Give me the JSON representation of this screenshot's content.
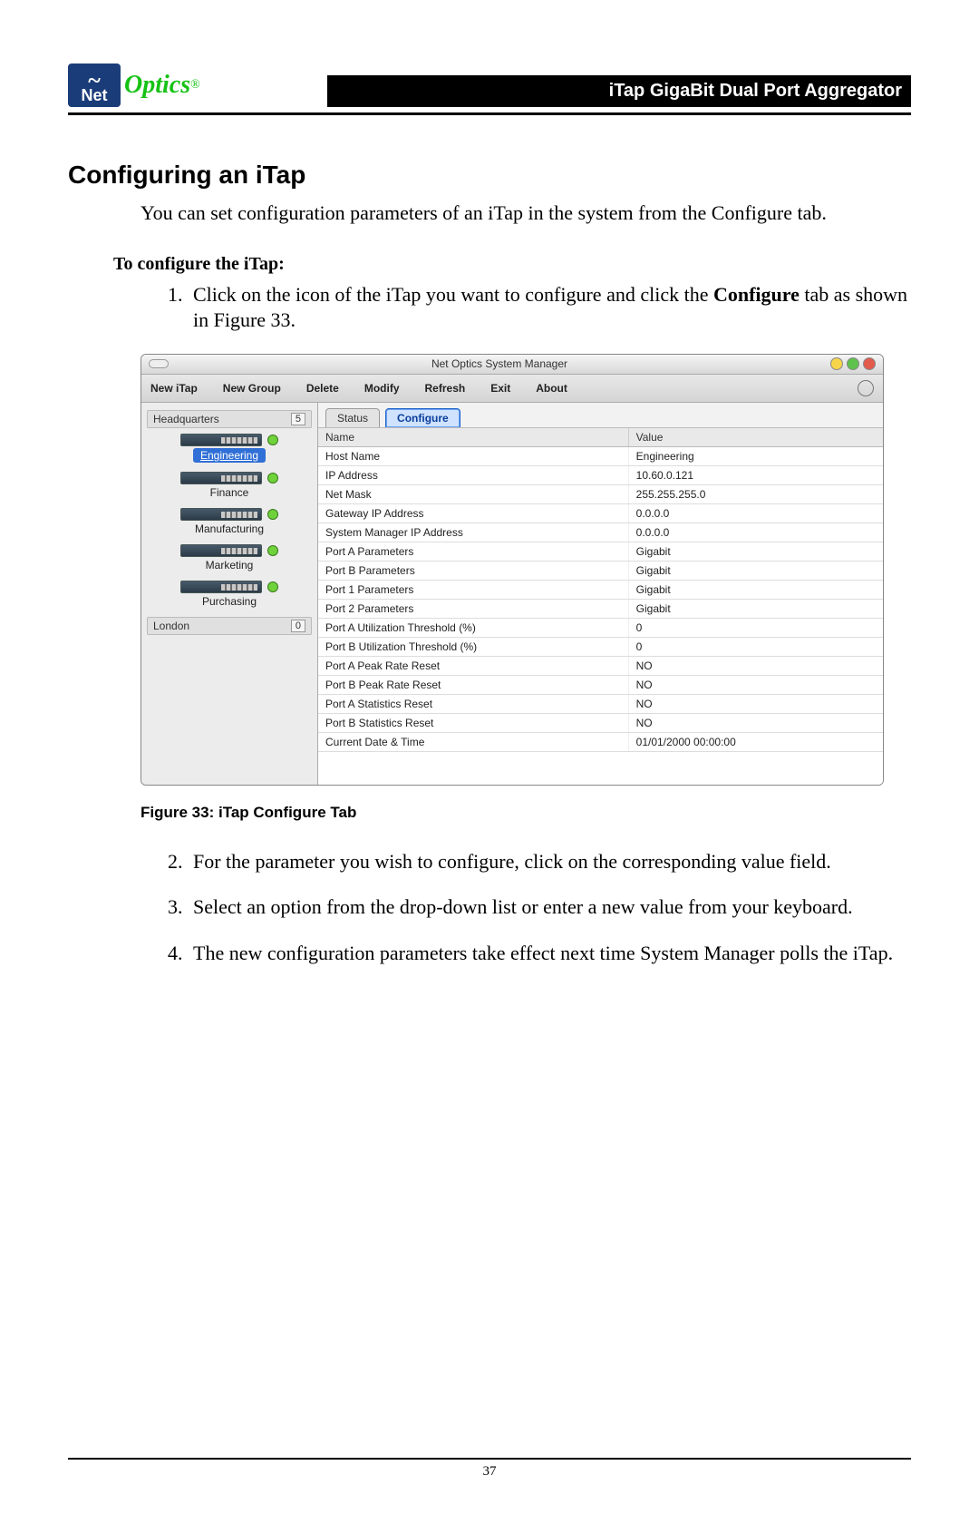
{
  "header": {
    "logo_net": "Net",
    "logo_optics": "Optics",
    "logo_reg": "®",
    "product_title": "iTap GigaBit Dual Port Aggregator"
  },
  "section": {
    "title": "Configuring an iTap",
    "intro": "You can set configuration parameters of an iTap in the system from the Configure tab.",
    "subhead": "To configure the iTap:",
    "step1_pre": "Click on the icon of the iTap you want to configure and click the ",
    "step1_bold": "Configure",
    "step1_post": " tab as shown in Figure 33.",
    "step2": "For the parameter you wish to configure, click on the corresponding value field.",
    "step3": "Select an option from the drop-down list or enter a new value from your keyboard.",
    "step4": "The new configuration parameters take effect next time System Manager polls the iTap."
  },
  "figure": {
    "label_bold": "Figure 33:",
    "label_rest": " iTap Configure Tab"
  },
  "app": {
    "window_title": "Net Optics System Manager",
    "menu": {
      "new_itap": "New iTap",
      "new_group": "New Group",
      "delete": "Delete",
      "modify": "Modify",
      "refresh": "Refresh",
      "exit": "Exit",
      "about": "About"
    },
    "sidebar": {
      "group1": {
        "name": "Headquarters",
        "count": "5"
      },
      "devices": [
        "Engineering",
        "Finance",
        "Manufacturing",
        "Marketing",
        "Purchasing"
      ],
      "group2": {
        "name": "London",
        "count": "0"
      }
    },
    "tabs": {
      "status": "Status",
      "configure": "Configure"
    },
    "grid": {
      "head_name": "Name",
      "head_value": "Value",
      "rows": [
        {
          "name": "Host Name",
          "value": "Engineering"
        },
        {
          "name": "IP Address",
          "value": "10.60.0.121"
        },
        {
          "name": "Net Mask",
          "value": "255.255.255.0"
        },
        {
          "name": "Gateway IP Address",
          "value": "0.0.0.0"
        },
        {
          "name": "System Manager IP Address",
          "value": "0.0.0.0"
        },
        {
          "name": "Port A Parameters",
          "value": "Gigabit"
        },
        {
          "name": "Port B Parameters",
          "value": "Gigabit"
        },
        {
          "name": "Port 1 Parameters",
          "value": "Gigabit"
        },
        {
          "name": "Port 2 Parameters",
          "value": "Gigabit"
        },
        {
          "name": "Port A Utilization Threshold (%)",
          "value": "0"
        },
        {
          "name": "Port B Utilization Threshold (%)",
          "value": "0"
        },
        {
          "name": "Port A Peak Rate Reset",
          "value": "NO"
        },
        {
          "name": "Port B Peak Rate Reset",
          "value": "NO"
        },
        {
          "name": "Port A Statistics Reset",
          "value": "NO"
        },
        {
          "name": "Port B Statistics Reset",
          "value": "NO"
        },
        {
          "name": "Current Date & Time",
          "value": "01/01/2000 00:00:00"
        }
      ]
    }
  },
  "page_number": "37"
}
